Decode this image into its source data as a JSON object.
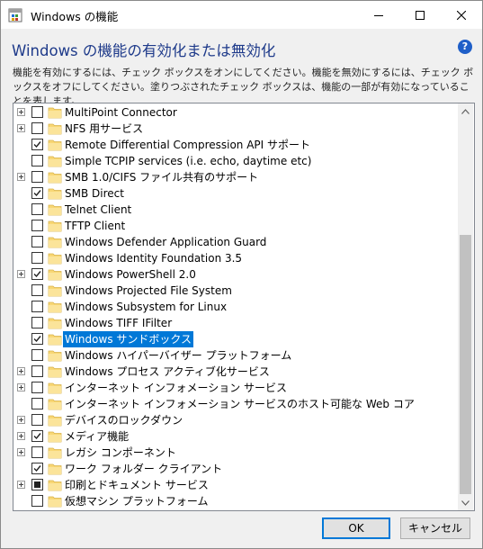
{
  "titlebar": {
    "title": "Windows の機能",
    "icon": "windows-features-icon",
    "controls": [
      "minimize-icon",
      "maximize-icon",
      "close-icon"
    ]
  },
  "heading": "Windows の機能の有効化または無効化",
  "help_icon": "?",
  "description": "機能を有効にするには、チェック ボックスをオンにしてください。機能を無効にするには、チェック ボックスをオフにしてください。塗りつぶされたチェック ボックスは、機能の一部が有効になっていることを表します。",
  "features": [
    {
      "label": "MultiPoint Connector",
      "expandable": true,
      "state": "unchecked"
    },
    {
      "label": "NFS 用サービス",
      "expandable": true,
      "state": "unchecked"
    },
    {
      "label": "Remote Differential Compression API サポート",
      "expandable": false,
      "state": "checked"
    },
    {
      "label": "Simple TCPIP services (i.e. echo, daytime etc)",
      "expandable": false,
      "state": "unchecked"
    },
    {
      "label": "SMB 1.0/CIFS ファイル共有のサポート",
      "expandable": true,
      "state": "unchecked"
    },
    {
      "label": "SMB Direct",
      "expandable": false,
      "state": "checked"
    },
    {
      "label": "Telnet Client",
      "expandable": false,
      "state": "unchecked"
    },
    {
      "label": "TFTP Client",
      "expandable": false,
      "state": "unchecked"
    },
    {
      "label": "Windows Defender Application Guard",
      "expandable": false,
      "state": "unchecked"
    },
    {
      "label": "Windows Identity Foundation 3.5",
      "expandable": false,
      "state": "unchecked"
    },
    {
      "label": "Windows PowerShell 2.0",
      "expandable": true,
      "state": "checked"
    },
    {
      "label": "Windows Projected File System",
      "expandable": false,
      "state": "unchecked"
    },
    {
      "label": "Windows Subsystem for Linux",
      "expandable": false,
      "state": "unchecked"
    },
    {
      "label": "Windows TIFF IFilter",
      "expandable": false,
      "state": "unchecked"
    },
    {
      "label": "Windows サンドボックス",
      "expandable": false,
      "state": "checked",
      "selected": true
    },
    {
      "label": "Windows ハイパーバイザー プラットフォーム",
      "expandable": false,
      "state": "unchecked"
    },
    {
      "label": "Windows プロセス アクティブ化サービス",
      "expandable": true,
      "state": "unchecked"
    },
    {
      "label": "インターネット インフォメーション サービス",
      "expandable": true,
      "state": "unchecked"
    },
    {
      "label": "インターネット インフォメーション サービスのホスト可能な Web コア",
      "expandable": false,
      "state": "unchecked"
    },
    {
      "label": "デバイスのロックダウン",
      "expandable": true,
      "state": "unchecked"
    },
    {
      "label": "メディア機能",
      "expandable": true,
      "state": "checked"
    },
    {
      "label": "レガシ コンポーネント",
      "expandable": true,
      "state": "unchecked"
    },
    {
      "label": "ワーク フォルダー クライアント",
      "expandable": false,
      "state": "checked"
    },
    {
      "label": "印刷とドキュメント サービス",
      "expandable": true,
      "state": "partial"
    },
    {
      "label": "仮想マシン プラットフォーム",
      "expandable": false,
      "state": "unchecked"
    }
  ],
  "buttons": {
    "ok": "OK",
    "cancel": "キャンセル"
  },
  "colors": {
    "accent": "#0078d7",
    "heading": "#1e3a8a",
    "folder": "#f8d775"
  }
}
